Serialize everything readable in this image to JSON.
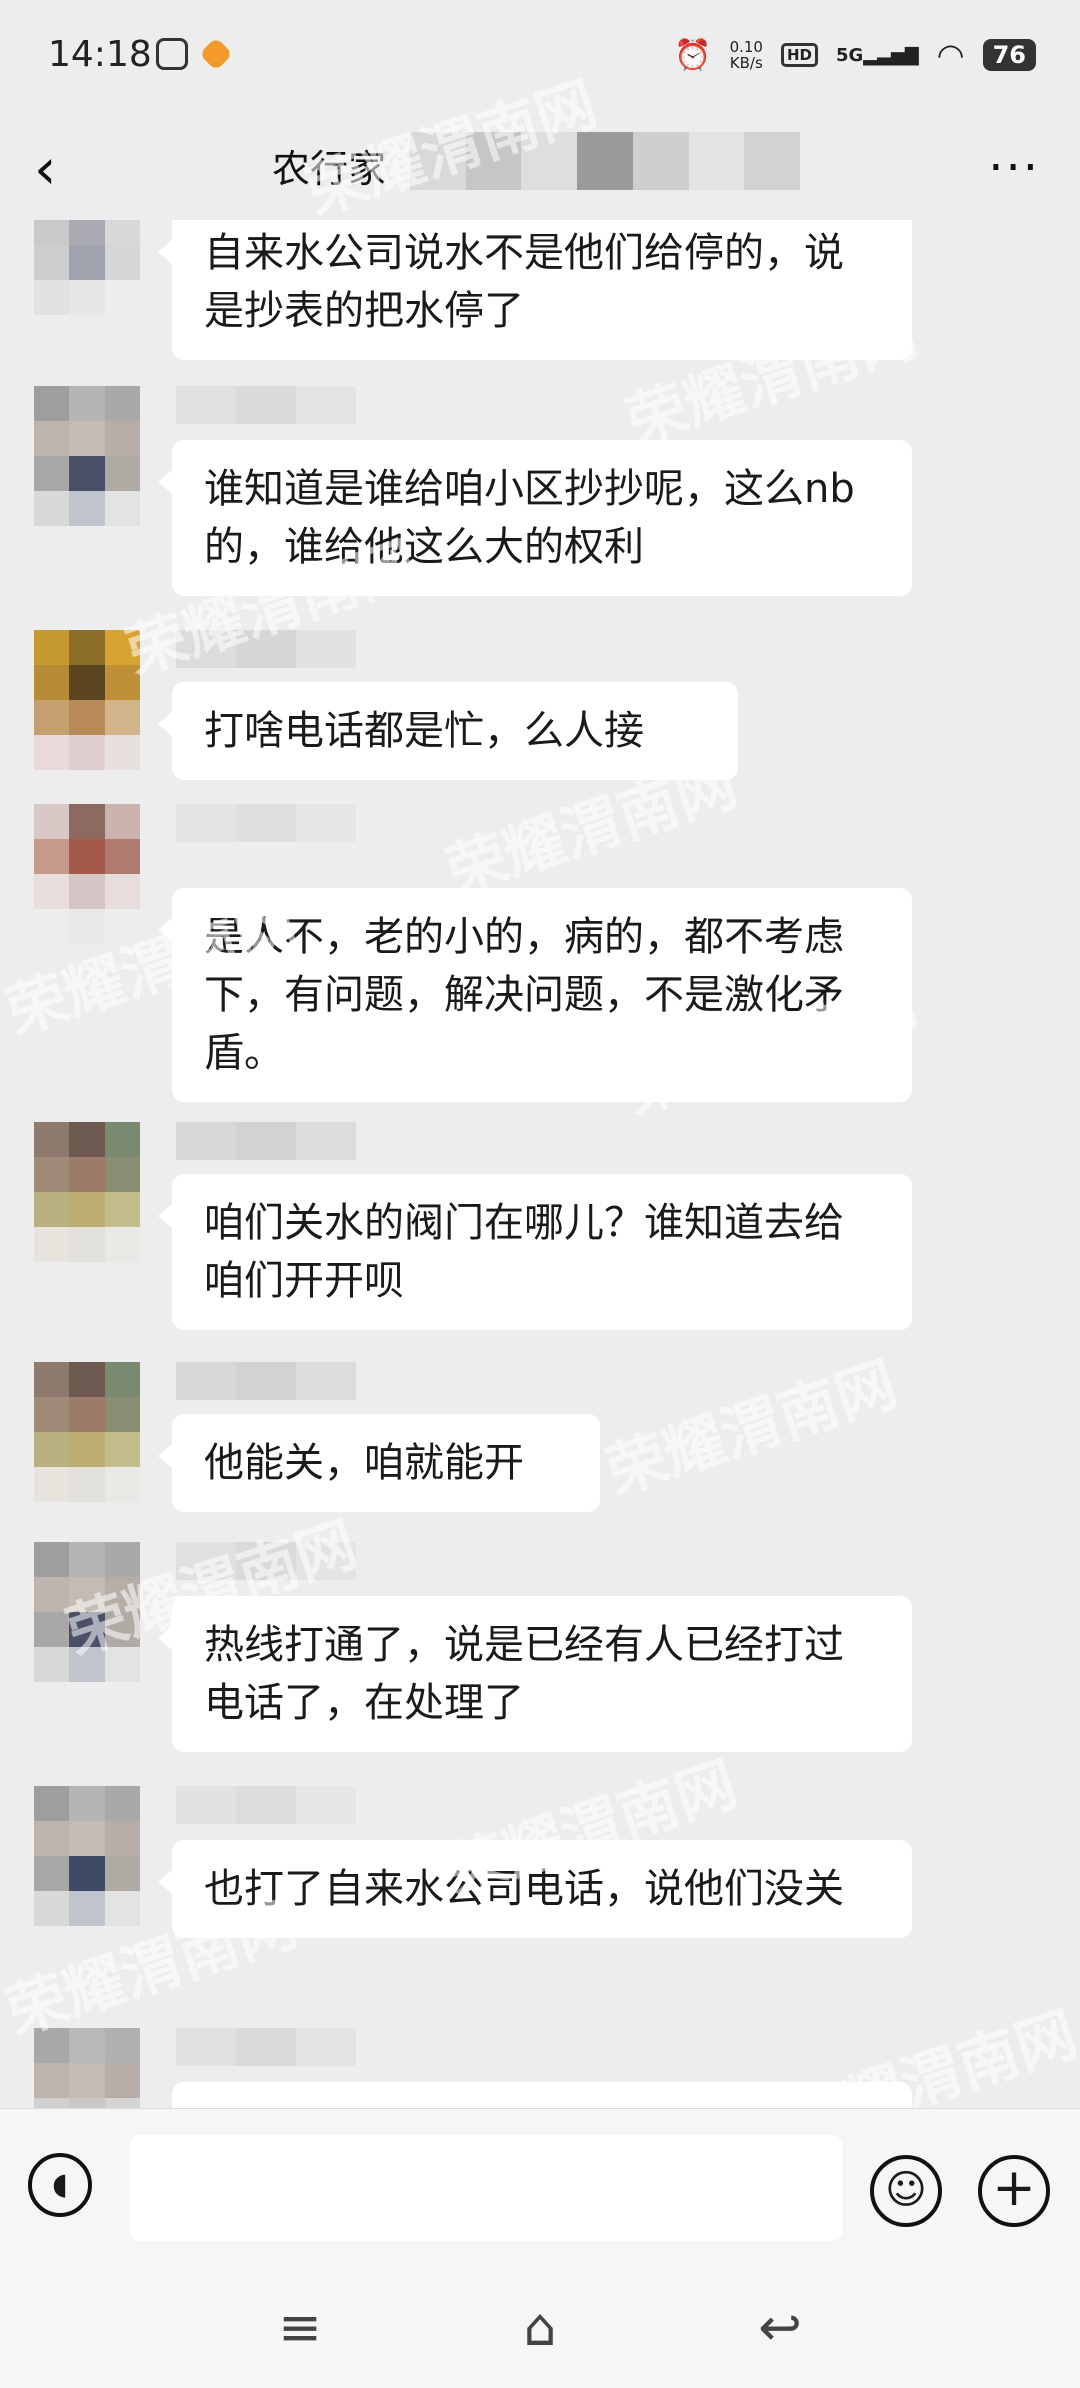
{
  "status_bar": {
    "time": "14:18",
    "net_speed": "0.10\nKB/s",
    "net_speed_value": "0.10",
    "net_speed_unit": "KB/s",
    "hd": "HD",
    "network": "5G",
    "battery": "76"
  },
  "header": {
    "title": "农行家",
    "back_icon": "back-arrow",
    "more_icon": "more-dots"
  },
  "messages": [
    {
      "text": "自来水公司说水不是他们给停的，说是抄表的把水停了"
    },
    {
      "text": "谁知道是谁给咱小区抄抄呢，这么nb的，谁给他这么大的权利"
    },
    {
      "text": "打啥电话都是忙，么人接"
    },
    {
      "text": "是人不，老的小的，病的，都不考虑下，有问题，解决问题，不是激化矛盾。"
    },
    {
      "text": "咱们关水的阀门在哪儿？谁知道去给咱们开开呗"
    },
    {
      "text": "他能关，咱就能开"
    },
    {
      "text": "热线打通了，说是已经有人已经打过电话了，在处理了"
    },
    {
      "text": "也打了自来水公司电话，说他们没关"
    }
  ],
  "watermark": "荣耀渭南网",
  "input_bar": {
    "voice_icon": "voice-icon",
    "emoji_icon": "emoji-icon",
    "plus_icon": "plus-icon"
  },
  "nav_bar": {
    "menu_icon": "menu-icon",
    "home_icon": "home-icon",
    "back_icon": "back-icon"
  },
  "colors": {
    "background": "#ededed",
    "bubble": "#ffffff"
  }
}
